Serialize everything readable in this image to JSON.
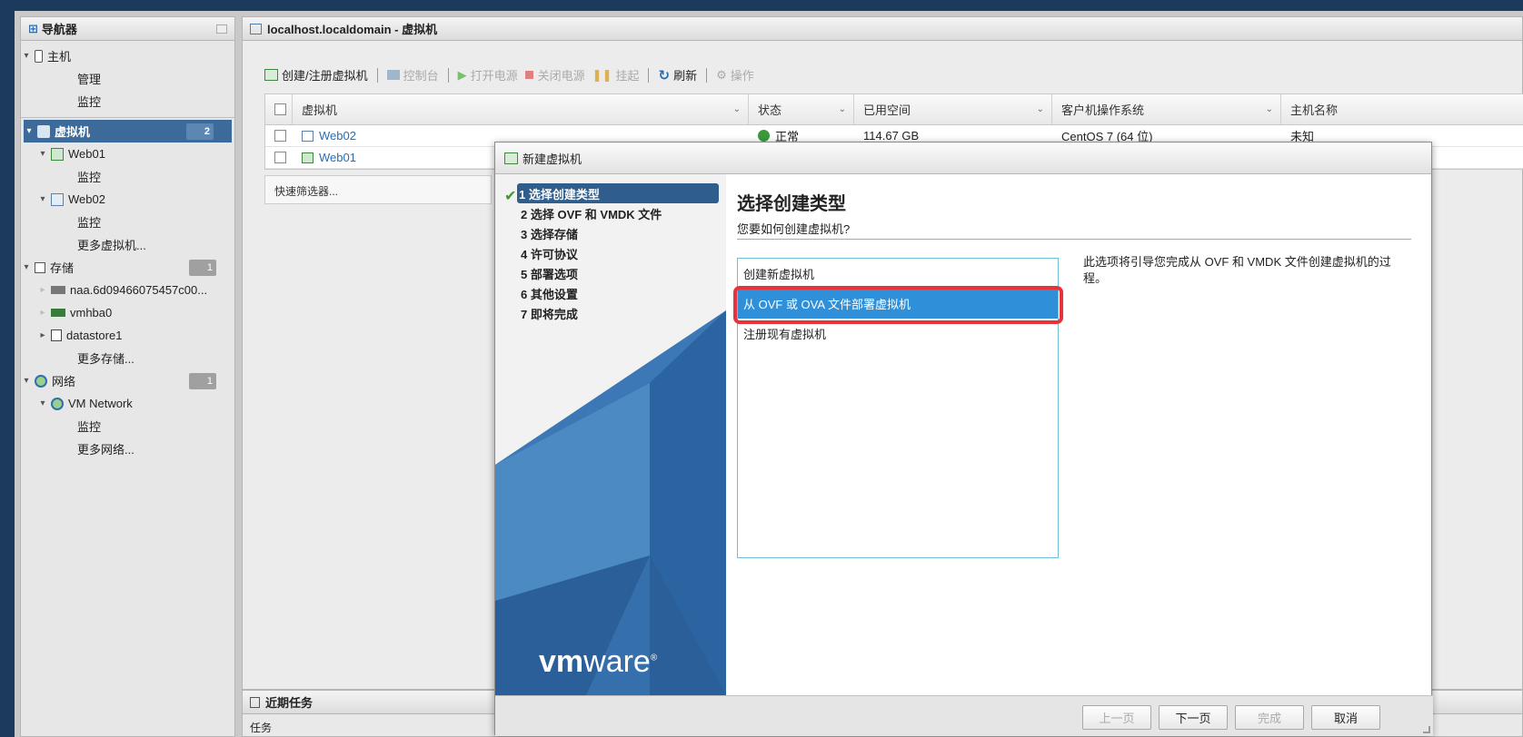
{
  "navigator": {
    "title": "导航器",
    "host": {
      "label": "主机",
      "children": [
        "管理",
        "监控"
      ]
    },
    "vms": {
      "label": "虚拟机",
      "count": "2"
    },
    "web01": {
      "label": "Web01",
      "child": "监控"
    },
    "web02": {
      "label": "Web02",
      "child": "监控"
    },
    "more_vms": "更多虚拟机...",
    "storage": {
      "label": "存储",
      "count": "1"
    },
    "storage_items": [
      "naa.6d09466075457c00...",
      "vmhba0",
      "datastore1"
    ],
    "more_storage": "更多存储...",
    "network": {
      "label": "网络",
      "count": "1"
    },
    "vm_network": {
      "label": "VM Network",
      "child": "监控"
    },
    "more_network": "更多网络..."
  },
  "main": {
    "title": "localhost.localdomain - 虚拟机",
    "toolbar": {
      "create": "创建/注册虚拟机",
      "console": "控制台",
      "power_on": "打开电源",
      "power_off": "关闭电源",
      "suspend": "挂起",
      "refresh": "刷新",
      "actions": "操作"
    },
    "grid": {
      "columns": [
        "虚拟机",
        "状态",
        "已用空间",
        "客户机操作系统",
        "主机名称"
      ],
      "rows": [
        {
          "name": "Web02",
          "status": "正常",
          "space": "114.67 GB",
          "os": "CentOS 7 (64 位)",
          "host": "未知"
        },
        {
          "name": "Web01"
        }
      ]
    },
    "quick_filter": "快速筛选器..."
  },
  "tasks": {
    "title": "近期任务",
    "column": "任务"
  },
  "dialog": {
    "title": "新建虚拟机",
    "steps": [
      "1 选择创建类型",
      "2 选择 OVF 和 VMDK 文件",
      "3 选择存储",
      "4 许可协议",
      "5 部署选项",
      "6 其他设置",
      "7 即将完成"
    ],
    "logo": {
      "bold": "vm",
      "rest": "ware",
      "mark": "®"
    },
    "page_title": "选择创建类型",
    "page_subtitle": "您要如何创建虚拟机?",
    "options": [
      "创建新虚拟机",
      "从 OVF 或 OVA 文件部署虚拟机",
      "注册现有虚拟机"
    ],
    "selected_option": 1,
    "description": "此选项将引导您完成从 OVF 和 VMDK 文件创建虚拟机的过程。",
    "buttons": {
      "back": "上一页",
      "next": "下一页",
      "finish": "完成",
      "cancel": "取消"
    }
  },
  "colors": {
    "accent": "#2f8fd8",
    "highlight": "#e8333b",
    "nav_selected": "#3c6a9a"
  }
}
